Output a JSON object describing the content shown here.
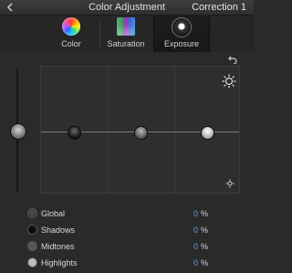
{
  "titlebar": {
    "title": "Color Adjustment",
    "preset": "Correction 1"
  },
  "tabs": [
    {
      "label": "Color",
      "icon": "color-wheel-icon",
      "active": false
    },
    {
      "label": "Saturation",
      "icon": "saturation-icon",
      "active": false
    },
    {
      "label": "Exposure",
      "icon": "exposure-icon",
      "active": true
    }
  ],
  "rows": [
    {
      "name": "Global",
      "value": "0",
      "unit": "%"
    },
    {
      "name": "Shadows",
      "value": "0",
      "unit": "%"
    },
    {
      "name": "Midtones",
      "value": "0",
      "unit": "%"
    },
    {
      "name": "Highlights",
      "value": "0",
      "unit": "%"
    }
  ],
  "colors": {
    "value_text": "#5aa0e6",
    "background": "#2a2a2a"
  }
}
